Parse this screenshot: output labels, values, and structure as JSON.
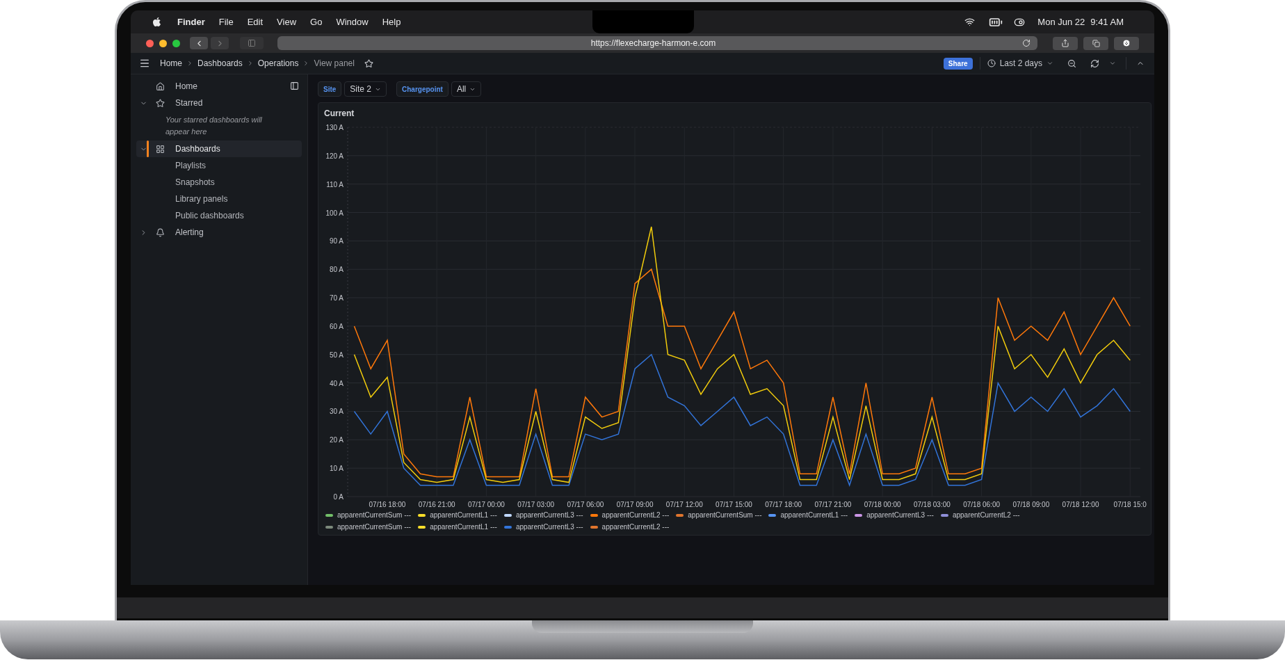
{
  "menubar": {
    "app": "Finder",
    "items": [
      "File",
      "Edit",
      "View",
      "Go",
      "Window",
      "Help"
    ],
    "date": "Mon Jun 22",
    "time": "9:41 AM"
  },
  "browser": {
    "url": "https://flexecharge-harmon-e.com"
  },
  "breadcrumb": [
    {
      "label": "Home",
      "current": false
    },
    {
      "label": "Dashboards",
      "current": false
    },
    {
      "label": "Operations",
      "current": false
    },
    {
      "label": "View panel",
      "current": true
    }
  ],
  "toolbar": {
    "share": "Share",
    "time_range": "Last 2 days"
  },
  "sidebar": {
    "items": [
      {
        "label": "Home",
        "kind": "home",
        "selected": false
      },
      {
        "label": "Starred",
        "kind": "star",
        "selected": false,
        "expanded": true,
        "note": "Your starred dashboards will appear here"
      },
      {
        "label": "Dashboards",
        "kind": "grid",
        "selected": true,
        "expanded": true,
        "children": [
          {
            "label": "Playlists",
            "selected": false
          },
          {
            "label": "Snapshots",
            "selected": false
          },
          {
            "label": "Library panels",
            "selected": false
          },
          {
            "label": "Public dashboards",
            "selected": false
          }
        ]
      },
      {
        "label": "Alerting",
        "kind": "bell",
        "selected": false,
        "expanded": false
      }
    ]
  },
  "variables": [
    {
      "label": "Site",
      "value": "Site 2"
    },
    {
      "label": "Chargepoint",
      "value": "All"
    }
  ],
  "panel": {
    "title": "Current",
    "chart_data": {
      "type": "line",
      "categories": [
        null,
        null,
        "07/16 18:00",
        null,
        null,
        "07/16 21:00",
        null,
        null,
        "07/17 00:00",
        null,
        null,
        "07/17 03:00",
        null,
        null,
        "07/17 06:00",
        null,
        null,
        "07/17 09:00",
        null,
        null,
        "07/17 12:00",
        null,
        null,
        "07/17 15:00",
        null,
        null,
        "07/17 18:00",
        null,
        null,
        "07/17 21:00",
        null,
        null,
        "07/18 00:00",
        null,
        null,
        "07/18 03:00",
        null,
        null,
        "07/18 06:00",
        null,
        null,
        "07/18 09:00",
        null,
        null,
        "07/18 12:00",
        null,
        null,
        "07/18 15:0"
      ],
      "ylim": [
        0,
        130
      ],
      "grid": true,
      "yticks": [
        {
          "value": 0,
          "label": "0 A"
        },
        {
          "value": 10,
          "label": "10 A"
        },
        {
          "value": 20,
          "label": "20 A"
        },
        {
          "value": 30,
          "label": "30 A"
        },
        {
          "value": 40,
          "label": "40 A"
        },
        {
          "value": 50,
          "label": "50 A"
        },
        {
          "value": 60,
          "label": "60 A"
        },
        {
          "value": 70,
          "label": "70 A"
        },
        {
          "value": 80,
          "label": "80 A"
        },
        {
          "value": 90,
          "label": "90 A"
        },
        {
          "value": 100,
          "label": "100 A"
        },
        {
          "value": 110,
          "label": "110 A"
        },
        {
          "value": 120,
          "label": "120 A"
        },
        {
          "value": 130,
          "label": "130 A"
        }
      ],
      "series": [
        {
          "color": "#3274d9",
          "values": [
            30,
            22,
            30,
            10,
            4,
            4,
            4,
            20,
            4,
            4,
            4,
            22,
            4,
            4,
            22,
            20,
            22,
            45,
            50,
            35,
            32,
            25,
            30,
            35,
            25,
            28,
            22,
            4,
            4,
            20,
            4,
            22,
            4,
            4,
            6,
            20,
            4,
            4,
            6,
            40,
            30,
            35,
            30,
            38,
            28,
            32,
            38,
            30
          ]
        },
        {
          "color": "#ff780a",
          "values": [
            60,
            45,
            55,
            15,
            8,
            7,
            7,
            35,
            7,
            7,
            7,
            38,
            7,
            7,
            35,
            28,
            30,
            75,
            80,
            60,
            60,
            45,
            55,
            65,
            45,
            48,
            40,
            8,
            8,
            35,
            8,
            40,
            8,
            8,
            10,
            35,
            8,
            8,
            10,
            70,
            55,
            60,
            55,
            65,
            50,
            60,
            70,
            60
          ]
        },
        {
          "color": "#f2cc0c",
          "values": [
            50,
            35,
            42,
            12,
            6,
            5,
            6,
            28,
            6,
            5,
            6,
            30,
            6,
            5,
            28,
            24,
            26,
            70,
            95,
            50,
            48,
            36,
            45,
            50,
            36,
            38,
            32,
            6,
            6,
            28,
            6,
            32,
            6,
            6,
            8,
            28,
            6,
            6,
            8,
            60,
            45,
            50,
            42,
            52,
            40,
            50,
            55,
            48
          ]
        }
      ]
    },
    "legend": [
      [
        {
          "name": "apparentCurrentSum ---",
          "color": "#73bf69"
        },
        {
          "name": "apparentCurrentL1 ---",
          "color": "#fade2a"
        },
        {
          "name": "apparentCurrentL3 ---",
          "color": "#c0d8ff"
        },
        {
          "name": "apparentCurrentL2 ---",
          "color": "#ff780a"
        },
        {
          "name": "apparentCurrentSum ---",
          "color": "#e0752d"
        },
        {
          "name": "apparentCurrentL1 ---",
          "color": "#5794f2"
        },
        {
          "name": "apparentCurrentL3 ---",
          "color": "#ca95e5"
        },
        {
          "name": "apparentCurrentL2 ---",
          "color": "#8f8fd8"
        }
      ],
      [
        {
          "name": "apparentCurrentSum ---",
          "color": "#7c8a7c"
        },
        {
          "name": "apparentCurrentL1 ---",
          "color": "#fade2a"
        },
        {
          "name": "apparentCurrentL3 ---",
          "color": "#3274d9"
        },
        {
          "name": "apparentCurrentL2 ---",
          "color": "#e0752d"
        }
      ]
    ]
  }
}
